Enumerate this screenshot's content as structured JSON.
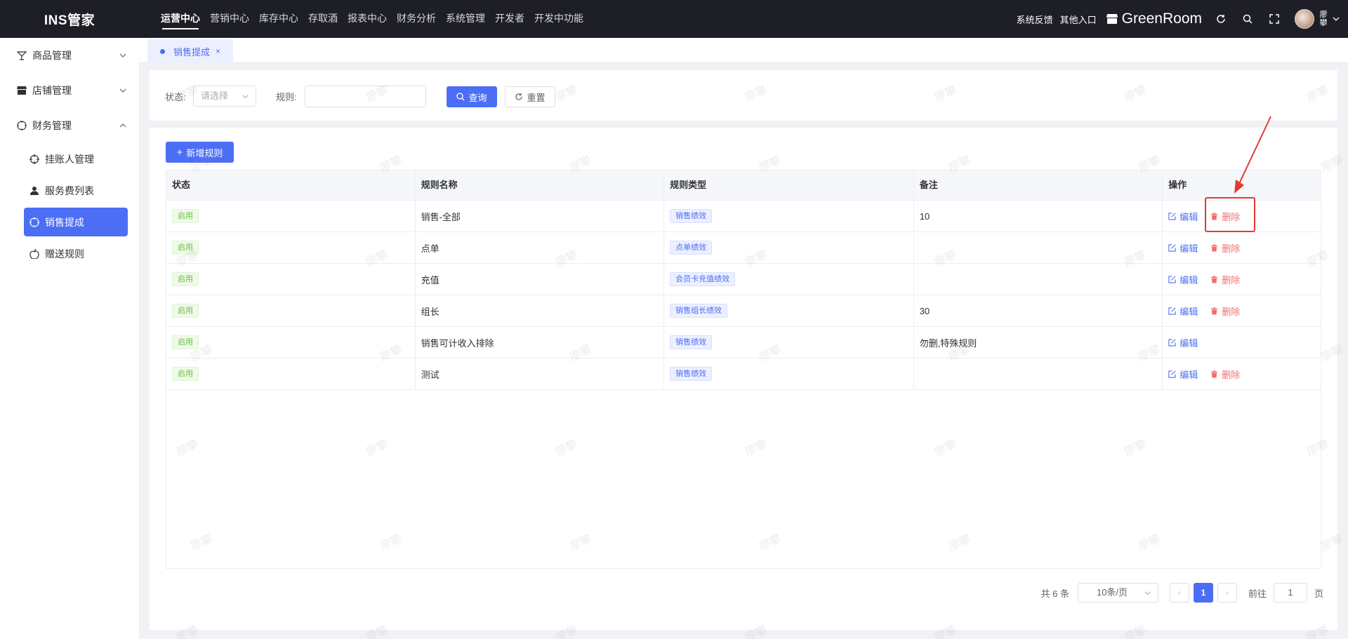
{
  "header": {
    "logo": "INS管家",
    "nav": [
      "运营中心",
      "营销中心",
      "库存中心",
      "存取酒",
      "报表中心",
      "财务分析",
      "系统管理",
      "开发者",
      "开发中功能"
    ],
    "active_nav": "运营中心",
    "feedback": "系统反馈",
    "other_entry": "其他入口",
    "store_name": "GreenRoom",
    "username": "廖攀"
  },
  "sidebar": {
    "groups": [
      {
        "label": "商品管理",
        "icon": "cocktail-icon"
      },
      {
        "label": "店铺管理",
        "icon": "store-icon"
      },
      {
        "label": "财务管理",
        "icon": "compass-icon"
      }
    ],
    "subitems": [
      {
        "label": "挂账人管理",
        "icon": "crosshair-icon"
      },
      {
        "label": "服务费列表",
        "icon": "user-icon"
      },
      {
        "label": "销售提成",
        "icon": "compass-icon"
      },
      {
        "label": "赠送规则",
        "icon": "apple-icon"
      }
    ],
    "active_sub": "销售提成"
  },
  "tabs": [
    {
      "label": "销售提成",
      "close": "×"
    }
  ],
  "filters": {
    "status_label": "状态:",
    "status_placeholder": "请选择",
    "rule_label": "规则:",
    "rule_value": "",
    "search_label": "查询",
    "reset_label": "重置"
  },
  "actions": {
    "add_label": "新增规则"
  },
  "table": {
    "columns": [
      "状态",
      "规则名称",
      "规则类型",
      "备注",
      "操作"
    ],
    "edit_label": "编辑",
    "delete_label": "删除",
    "rows": [
      {
        "status": "启用",
        "name": "销售-全部",
        "type": "销售绩效",
        "note": "10",
        "can_delete": true
      },
      {
        "status": "启用",
        "name": "点单",
        "type": "点单绩效",
        "note": "",
        "can_delete": true
      },
      {
        "status": "启用",
        "name": "充值",
        "type": "会员卡充值绩效",
        "note": "",
        "can_delete": true
      },
      {
        "status": "启用",
        "name": "组长",
        "type": "销售组长绩效",
        "note": "30",
        "can_delete": true
      },
      {
        "status": "启用",
        "name": "销售可计收入排除",
        "type": "销售绩效",
        "note": "勿删,特殊规则",
        "can_delete": false
      },
      {
        "status": "启用",
        "name": "测试",
        "type": "销售绩效",
        "note": "",
        "can_delete": true
      }
    ]
  },
  "pagination": {
    "total": "共 6 条",
    "page_size": "10条/页",
    "prev": "‹",
    "current": "1",
    "next": "›",
    "goto_label": "前往",
    "goto_value": "1",
    "page_unit": "页"
  },
  "watermark": "廖攀",
  "colors": {
    "primary": "#4c6ef5",
    "danger": "#f56c6c",
    "success": "#67c23a",
    "header_bg": "#1d1e26",
    "annotation": "#e53935"
  }
}
